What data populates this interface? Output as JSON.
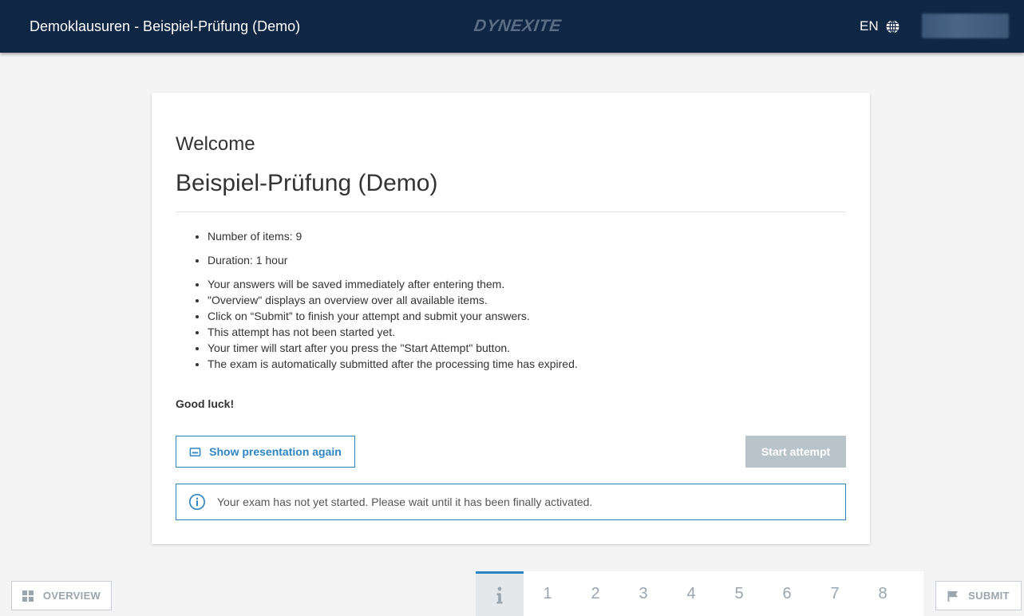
{
  "header": {
    "title": "Demoklausuren - Beispiel-Prüfung (Demo)",
    "logo": "DYNEXITE",
    "language": "EN",
    "language_icon": "globe-icon"
  },
  "card": {
    "welcome": "Welcome",
    "exam_name": "Beispiel-Prüfung (Demo)",
    "info_items": [
      "Number of items: 9",
      "Duration: 1 hour",
      "Your answers will be saved immediately after entering them.",
      "\"Overview\" displays an overview over all available items.",
      "Click on “Submit” to finish your attempt and submit your answers.",
      "This attempt has not been started yet.",
      "Your timer will start after you press the \"Start Attempt\" button.",
      "The exam is automatically submitted after the processing time has expired."
    ],
    "good_luck": "Good luck!",
    "show_presentation_label": "Show presentation again",
    "start_attempt_label": "Start attempt",
    "notice": "Your exam has not yet started. Please wait until it has been finally activated."
  },
  "footer": {
    "overview_label": "OVERVIEW",
    "submit_label": "SUBMIT",
    "item_numbers": [
      "1",
      "2",
      "3",
      "4",
      "5",
      "6",
      "7",
      "8"
    ]
  },
  "colors": {
    "header_bg": "#0f2744",
    "accent": "#2e86c1",
    "disabled": "#b9c3ca"
  }
}
